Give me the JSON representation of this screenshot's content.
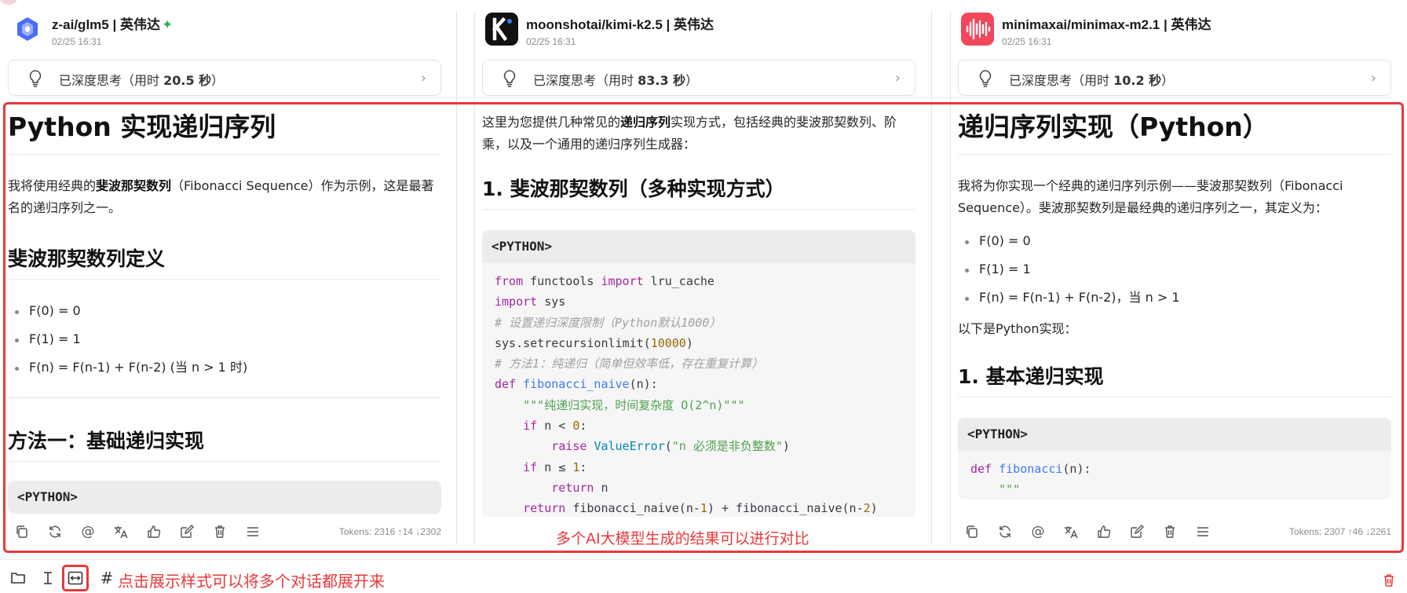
{
  "columns": [
    {
      "model": "z-ai/glm5 | 英伟达",
      "time": "02/25 16:31",
      "think_prefix": "已深度思考（用时 ",
      "think_value": "20.5 秒",
      "think_suffix": "）",
      "h1": "Python 实现递归序列",
      "intro_pre": "我将使用经典的",
      "intro_bold": "斐波那契数列",
      "intro_post": "（Fibonacci Sequence）作为示例，这是最著名的递归序列之一。",
      "h2a": "斐波那契数列定义",
      "bullets": [
        "F(0) = 0",
        "F(1) = 1",
        "F(n) = F(n-1) + F(n-2) (当 n > 1 时)"
      ],
      "h2b": "方法一：基础递归实现",
      "code_label": "<PYTHON>",
      "tokens": "Tokens: 2316 ↑14 ↓2302"
    },
    {
      "model": "moonshotai/kimi-k2.5 | 英伟达",
      "time": "02/25 16:31",
      "think_prefix": "已深度思考（用时 ",
      "think_value": "83.3 秒",
      "think_suffix": "）",
      "intro_pre": "这里为您提供几种常见的",
      "intro_bold": "递归序列",
      "intro_post": "实现方式，包括经典的斐波那契数列、阶乘，以及一个通用的递归序列生成器：",
      "h2a": "1. 斐波那契数列（多种实现方式）",
      "code_label": "<PYTHON>",
      "code_lines": [
        "from functools import lru_cache",
        "import sys",
        "# 设置递归深度限制（Python默认1000）",
        "sys.setrecursionlimit(10000)",
        "# 方法1：纯递归（简单但效率低，存在重复计算）",
        "def fibonacci_naive(n):",
        "    \"\"\"纯递归实现，时间复杂度 O(2^n)\"\"\"",
        "    if n < 0:",
        "        raise ValueError(\"n 必须是非负整数\")",
        "    if n ≤ 1:",
        "        return n",
        "    return fibonacci_naive(n-1) + fibonacci_naive(n-2)"
      ]
    },
    {
      "model": "minimaxai/minimax-m2.1 | 英伟达",
      "time": "02/25 16:31",
      "think_prefix": "已深度思考（用时 ",
      "think_value": "10.2 秒",
      "think_suffix": "）",
      "h1": "递归序列实现（Python）",
      "intro": "我将为你实现一个经典的递归序列示例——斐波那契数列（Fibonacci Sequence）。斐波那契数列是最经典的递归序列之一，其定义为：",
      "bullets": [
        "F(0) = 0",
        "F(1) = 1",
        "F(n) = F(n-1) + F(n-2)，当 n > 1"
      ],
      "after": "以下是Python实现：",
      "h2a": "1. 基本递归实现",
      "code_label": "<PYTHON>",
      "code_lines": [
        "def fibonacci(n):",
        "    \"\"\""
      ],
      "tokens": "Tokens: 2307 ↑46 ↓2261"
    }
  ],
  "annotation_compare": "多个AI大模型生成的结果可以进行对比",
  "annotation_display": "点击展示样式可以将多个对话都展开来",
  "bottom_hash": "#",
  "colors": {
    "annotation_red": "#e8393b",
    "glm_blue": "#4a6cf7",
    "kimi_black": "#111111",
    "minimax_red": "#f2475b"
  },
  "icons": {
    "message_toolbar": [
      "copy-icon",
      "regenerate-icon",
      "mention-icon",
      "translate-icon",
      "thumbs-up-icon",
      "edit-icon",
      "delete-icon",
      "menu-icon"
    ],
    "bottom_bar": [
      "folder-icon",
      "text-cursor-icon",
      "expand-horizontal-icon",
      "hash-icon",
      "trash-icon"
    ]
  }
}
